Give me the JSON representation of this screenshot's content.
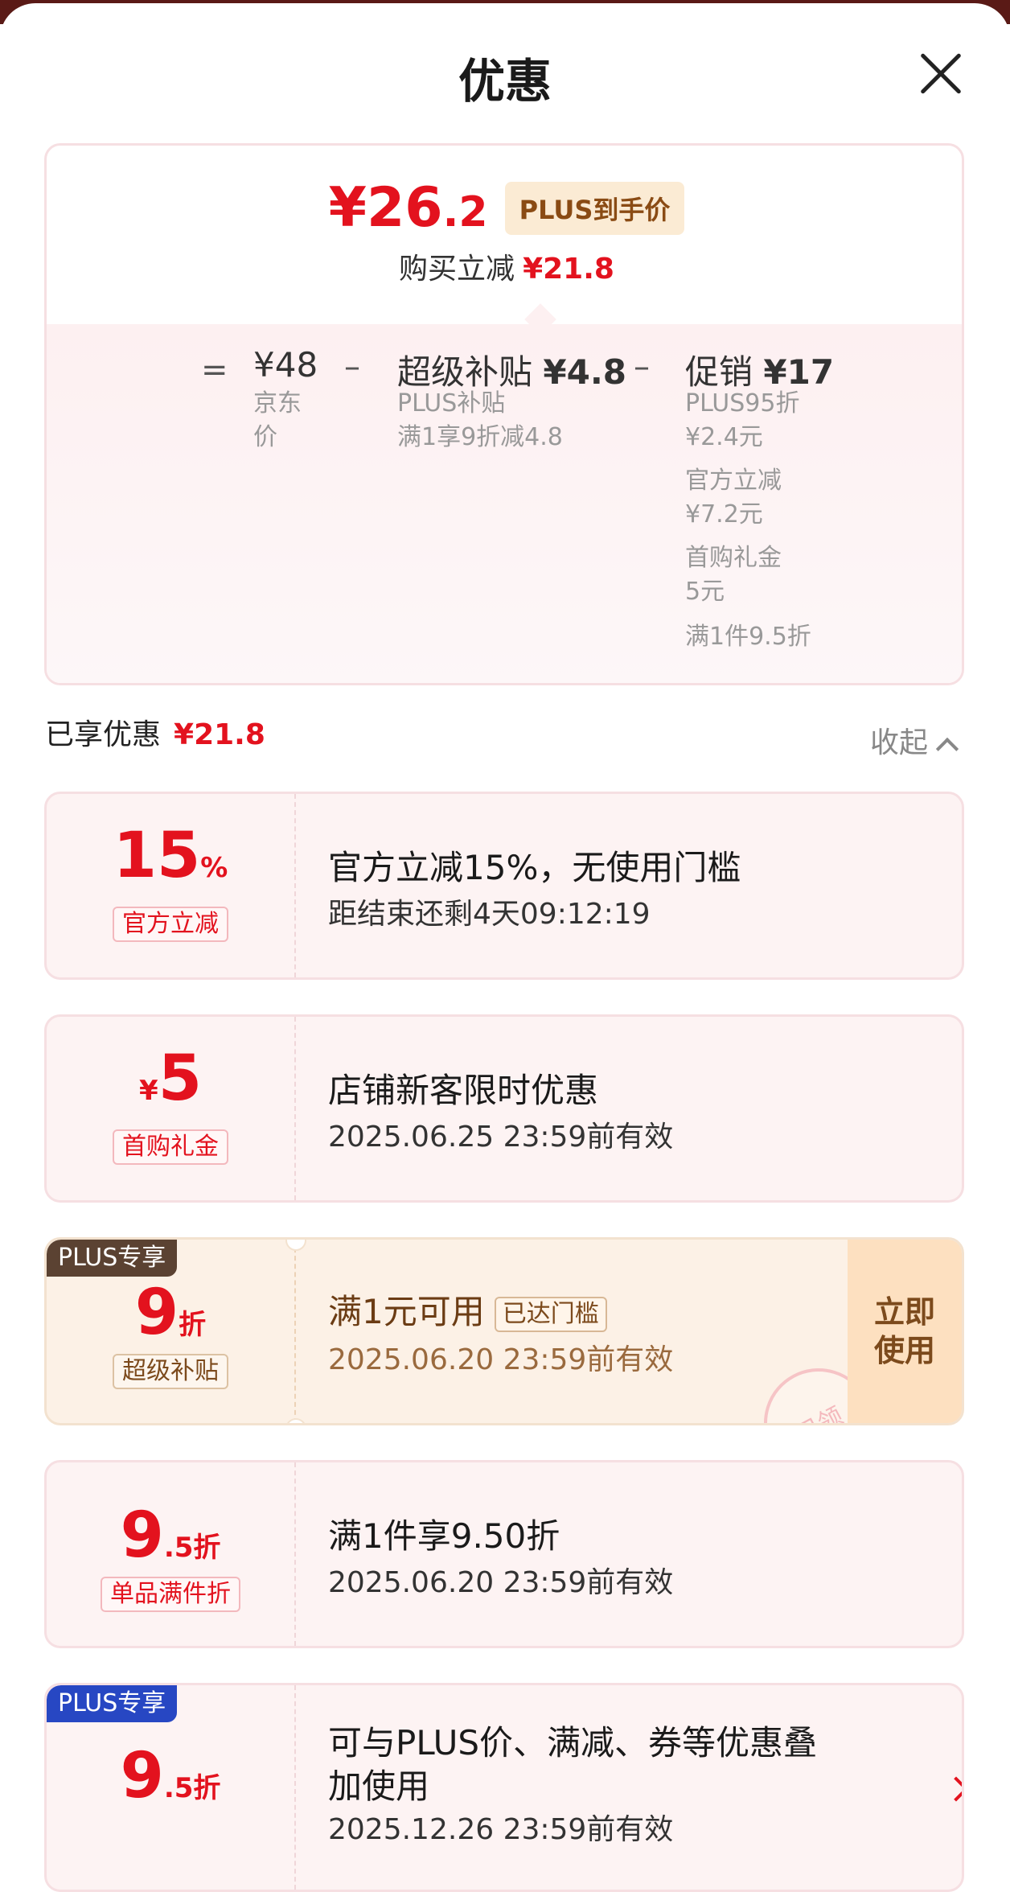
{
  "sheet": {
    "title": "优惠"
  },
  "summary": {
    "price_currency": "¥",
    "price_int": "26",
    "price_dec": ".2",
    "price_tag": "PLUS到手价",
    "buy_off_label": "购买立减",
    "buy_off_value": "¥21.8",
    "breakdown": {
      "eq": "=",
      "minus": "–",
      "jd_price": "¥48",
      "jd_label_1": "京东",
      "jd_label_2": "价",
      "subsidy_name": "超级补贴",
      "subsidy_value": "¥4.8",
      "subsidy_d1": "PLUS补贴",
      "subsidy_d2": "满1享9折减4.8",
      "promo_name": "促销",
      "promo_value": "¥17",
      "promo_d1": "PLUS95折",
      "promo_d2": "¥2.4元",
      "promo_d3": "官方立减",
      "promo_d4": "¥7.2元",
      "promo_d5": "首购礼金",
      "promo_d6": "5元",
      "promo_d7": "满1件9.5折"
    }
  },
  "enjoyed": {
    "label": "已享优惠",
    "value": "¥21.8",
    "collapse": "收起"
  },
  "cards": [
    {
      "big": "15",
      "unit": "%",
      "tag": "官方立减",
      "title": "官方立减15%，无使用门槛",
      "sub": "距结束还剩4天09:12:19"
    },
    {
      "currency": "¥",
      "big": "5",
      "tag": "首购礼金",
      "title": "店铺新客限时优惠",
      "sub": "2025.06.25 23:59前有效"
    },
    {
      "badge": "PLUS专享",
      "big": "9",
      "unit": "折",
      "tag": "超级补贴",
      "title": "满1元可用",
      "status": "已达门槛",
      "sub": "2025.06.20 23:59前有效",
      "button": "立即使用",
      "stamp": "已领"
    },
    {
      "big": "9",
      "dec": ".5折",
      "tag": "单品满件折",
      "title": "满1件享9.50折",
      "sub": "2025.06.20 23:59前有效"
    },
    {
      "badge": "PLUS专享",
      "big": "9",
      "dec": ".5折",
      "title_1": "可与PLUS价、满减、券等优惠叠",
      "title_2": "加使用",
      "sub": "2025.12.26 23:59前有效"
    }
  ],
  "colors": {
    "red": "#e3121e",
    "plus_brown": "#5b4232",
    "plus_blue": "#2747c3",
    "button_bg": "#fde0c0"
  },
  "icons": [
    "close-icon",
    "chevron-up-icon",
    "chevron-right-icon"
  ]
}
